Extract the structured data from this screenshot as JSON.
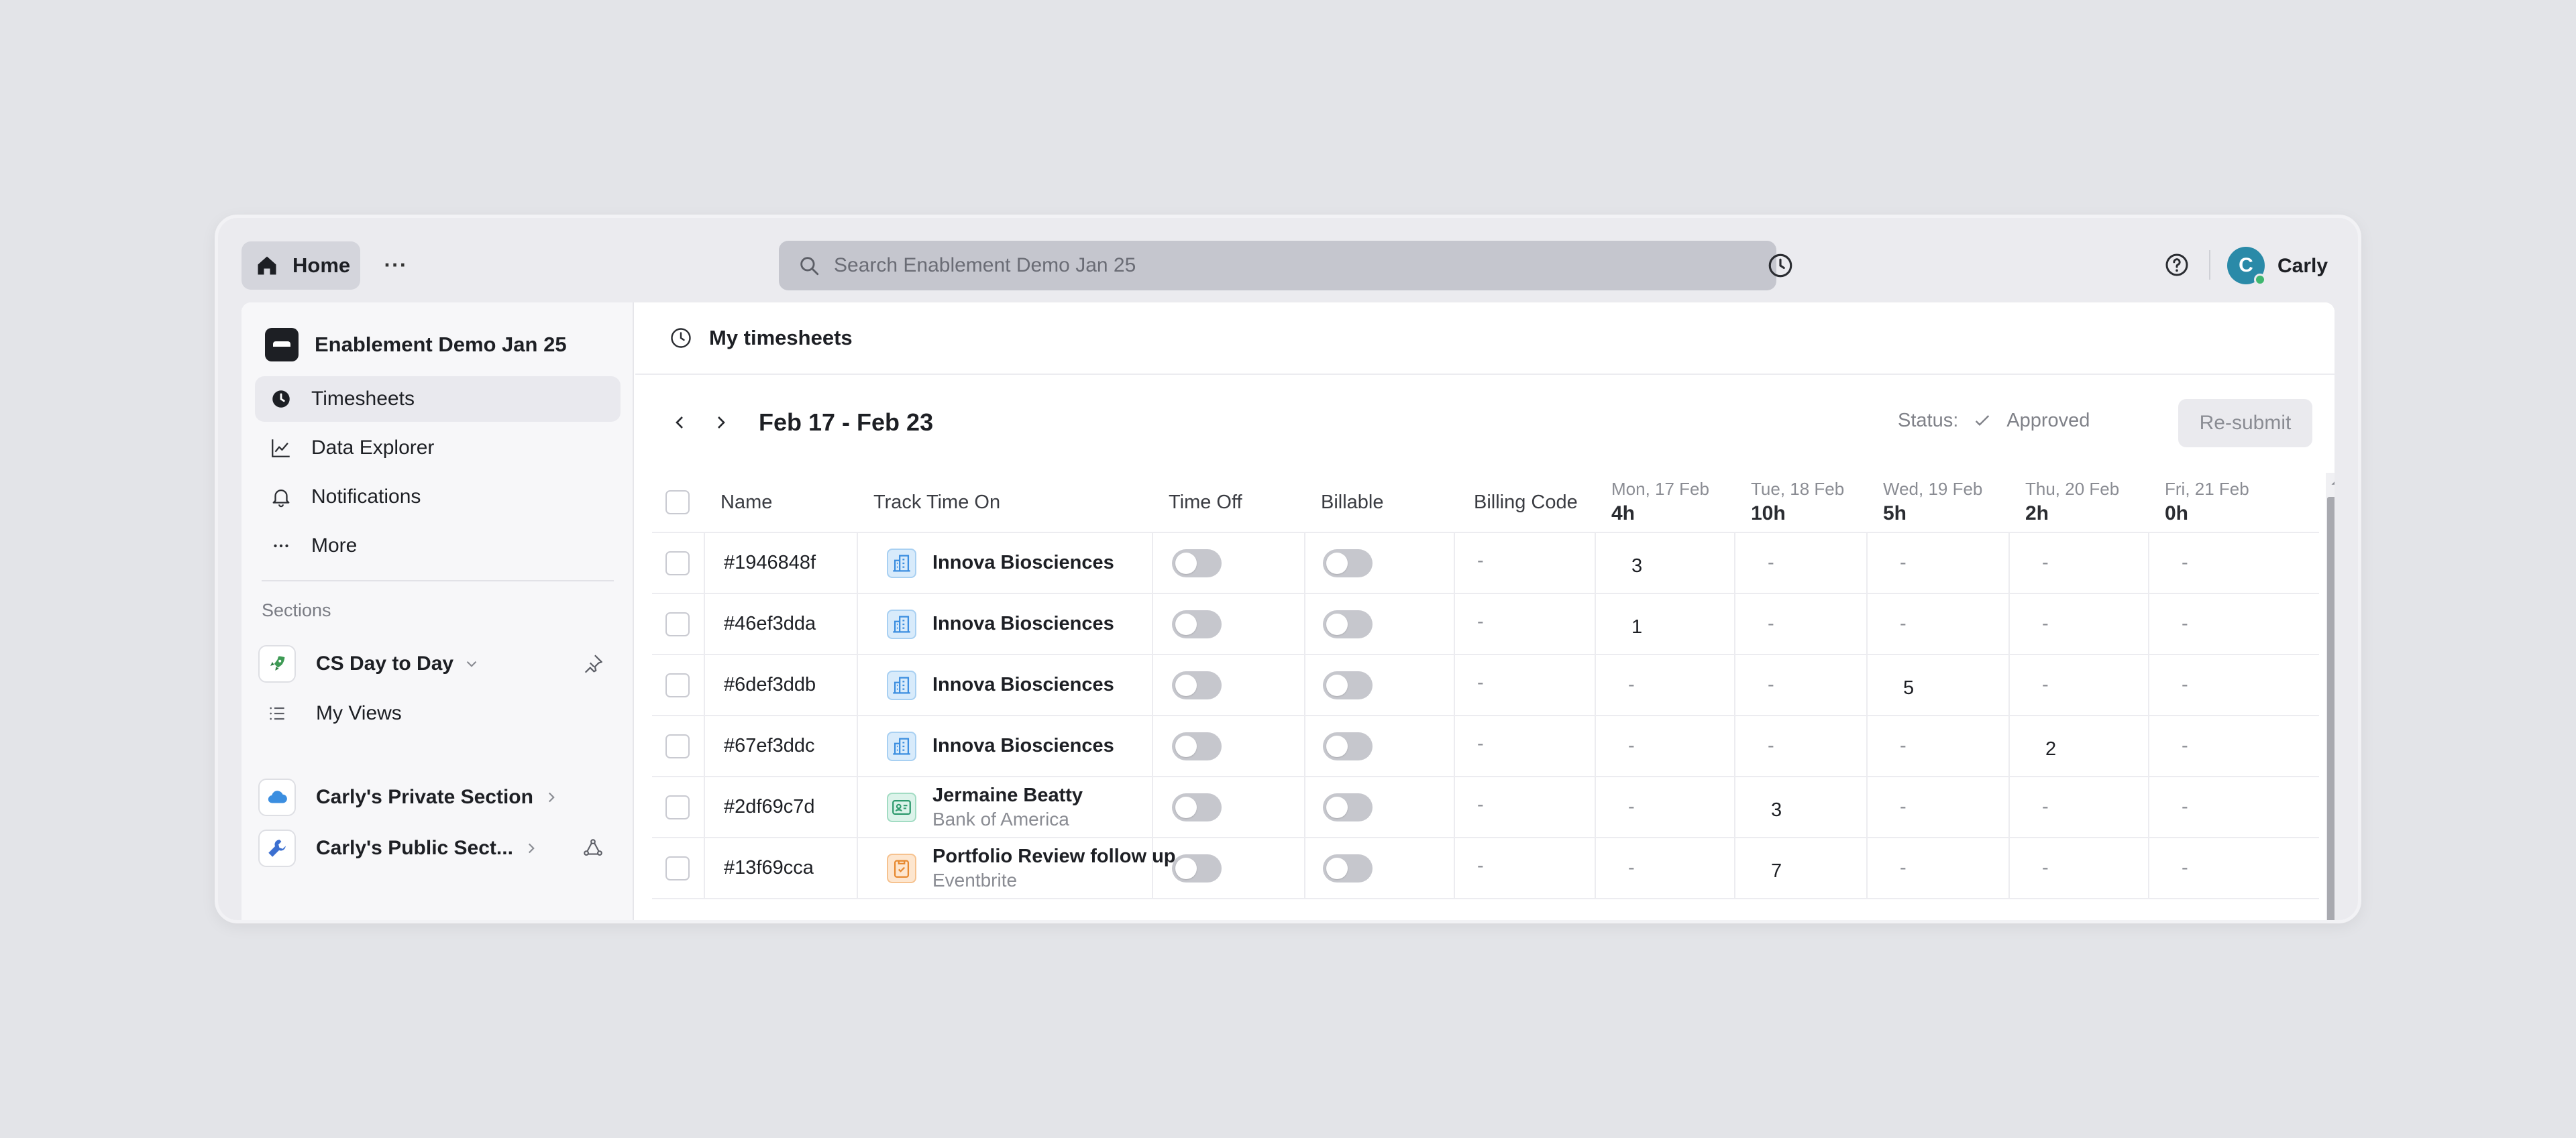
{
  "topbar": {
    "home_label": "Home",
    "more_label": "···",
    "search_placeholder": "Search Enablement Demo Jan 25",
    "user_initial": "C",
    "user_name": "Carly"
  },
  "sidebar": {
    "workspace_name": "Enablement Demo Jan 25",
    "nav": [
      {
        "label": "Timesheets",
        "icon": "clock-icon",
        "active": true
      },
      {
        "label": "Data Explorer",
        "icon": "chart-line-icon"
      },
      {
        "label": "Notifications",
        "icon": "bell-icon"
      },
      {
        "label": "More",
        "icon": "more-icon"
      }
    ],
    "sections_heading": "Sections",
    "sections": [
      {
        "label": "CS Day to Day",
        "icon": "rocket-icon"
      },
      {
        "label": "My Views",
        "icon": "list-icon"
      },
      {
        "label": "Carly's Private Section",
        "icon": "cloud-icon"
      },
      {
        "label": "Carly's Public Sect...",
        "icon": "wrench-icon"
      }
    ]
  },
  "main": {
    "header_title": "My timesheets",
    "week_label": "Feb 17 - Feb 23",
    "status_label": "Status:",
    "status_value": "Approved",
    "resubmit_label": "Re-submit"
  },
  "table": {
    "columns": {
      "name": "Name",
      "track": "Track Time On",
      "timeoff": "Time Off",
      "billable": "Billable",
      "billing": "Billing Code"
    },
    "days": [
      {
        "date": "Mon, 17 Feb",
        "hours": "4h"
      },
      {
        "date": "Tue, 18 Feb",
        "hours": "10h"
      },
      {
        "date": "Wed, 19 Feb",
        "hours": "5h"
      },
      {
        "date": "Thu, 20 Feb",
        "hours": "2h"
      },
      {
        "date": "Fri, 21 Feb",
        "hours": "0h"
      }
    ],
    "rows": [
      {
        "id": "#1946848f",
        "track_title": "Innova Biosciences",
        "track_sub": "",
        "billing": "-",
        "days": [
          "3",
          "-",
          "-",
          "-",
          "-"
        ]
      },
      {
        "id": "#46ef3dda",
        "track_title": "Innova Biosciences",
        "track_sub": "",
        "billing": "-",
        "days": [
          "1",
          "-",
          "-",
          "-",
          "-"
        ]
      },
      {
        "id": "#6def3ddb",
        "track_title": "Innova Biosciences",
        "track_sub": "",
        "billing": "-",
        "days": [
          "-",
          "-",
          "5",
          "-",
          "-"
        ]
      },
      {
        "id": "#67ef3ddc",
        "track_title": "Innova Biosciences",
        "track_sub": "",
        "billing": "-",
        "days": [
          "-",
          "-",
          "-",
          "2",
          "-"
        ]
      },
      {
        "id": "#2df69c7d",
        "track_title": "Jermaine Beatty",
        "track_sub": "Bank of America",
        "billing": "-",
        "days": [
          "-",
          "3",
          "-",
          "-",
          "-"
        ]
      },
      {
        "id": "#13f69cca",
        "track_title": "Portfolio Review follow up",
        "track_sub": "Eventbrite",
        "billing": "-",
        "days": [
          "-",
          "7",
          "-",
          "-",
          "-"
        ]
      }
    ]
  },
  "colors": {
    "background": "#e3e4e8",
    "accent_avatar": "#2a8aa8",
    "online": "#3fb76f",
    "toggle_off": "#c6c7cd"
  }
}
